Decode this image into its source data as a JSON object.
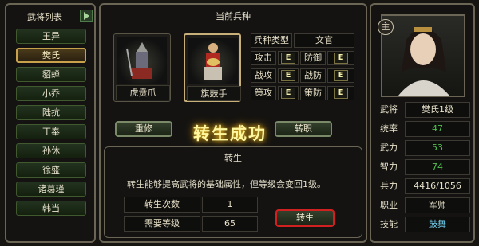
{
  "left_panel": {
    "title": "武将列表",
    "generals": [
      "王异",
      "樊氏",
      "貂蝉",
      "小乔",
      "陆抗",
      "丁奉",
      "孙休",
      "徐盛",
      "诸葛瑾",
      "韩当"
    ],
    "selected_index": 1
  },
  "center_panel": {
    "title": "当前兵种",
    "units": [
      {
        "name": "虎贲爪"
      },
      {
        "name": "旗鼓手"
      }
    ],
    "unit_type_label": "兵种类型",
    "unit_type_value": "文官",
    "stats": [
      {
        "label": "攻击",
        "value": "E"
      },
      {
        "label": "防御",
        "value": "E"
      },
      {
        "label": "战攻",
        "value": "E"
      },
      {
        "label": "战防",
        "value": "E"
      },
      {
        "label": "策攻",
        "value": "E"
      },
      {
        "label": "策防",
        "value": "E"
      }
    ],
    "refit_label": "重修",
    "switch_label": "转职",
    "banner": "转生成功",
    "rebirth": {
      "title": "转生",
      "desc": "转生能够提高武将的基础属性，但等级会变回1级。",
      "count_label": "转生次数",
      "count_value": "1",
      "level_label": "需要等级",
      "level_value": "65",
      "button_label": "转生"
    }
  },
  "right_panel": {
    "badge": "主",
    "rows": [
      {
        "label": "武将",
        "value": "樊氏1级",
        "color": "#e8e2cc"
      },
      {
        "label": "统率",
        "value": "47",
        "color": "#4fc04f"
      },
      {
        "label": "武力",
        "value": "53",
        "color": "#4fc04f"
      },
      {
        "label": "智力",
        "value": "74",
        "color": "#4fc04f"
      },
      {
        "label": "兵力",
        "value": "4416/1056",
        "color": "#e8e2cc"
      },
      {
        "label": "职业",
        "value": "军师",
        "color": "#e8e2cc"
      },
      {
        "label": "技能",
        "value": "鼓舞",
        "color": "#6ec8e6"
      }
    ]
  },
  "colors": {
    "accent": "#c8a24a",
    "panel_border": "#6a6555",
    "highlight_button": "#d02020"
  }
}
